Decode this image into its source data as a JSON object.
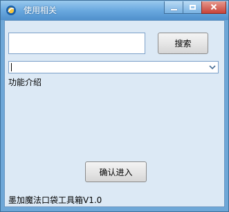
{
  "window": {
    "title": "使用相关"
  },
  "search": {
    "value": "",
    "placeholder": "",
    "button_label": "搜索"
  },
  "dropdown": {
    "selected": ""
  },
  "section": {
    "label": "功能介绍"
  },
  "actions": {
    "confirm_label": "确认进入"
  },
  "footer": {
    "text": "墨加魔法口袋工具箱V1.0"
  },
  "colors": {
    "titlebar": "#6aa9df",
    "client_bg": "#dce9f5",
    "close_button": "#c7433a"
  },
  "icons": {
    "app": "app-logo-icon",
    "minimize": "minimize-icon",
    "maximize": "maximize-icon",
    "close": "close-icon",
    "dropdown": "chevron-down-icon"
  }
}
